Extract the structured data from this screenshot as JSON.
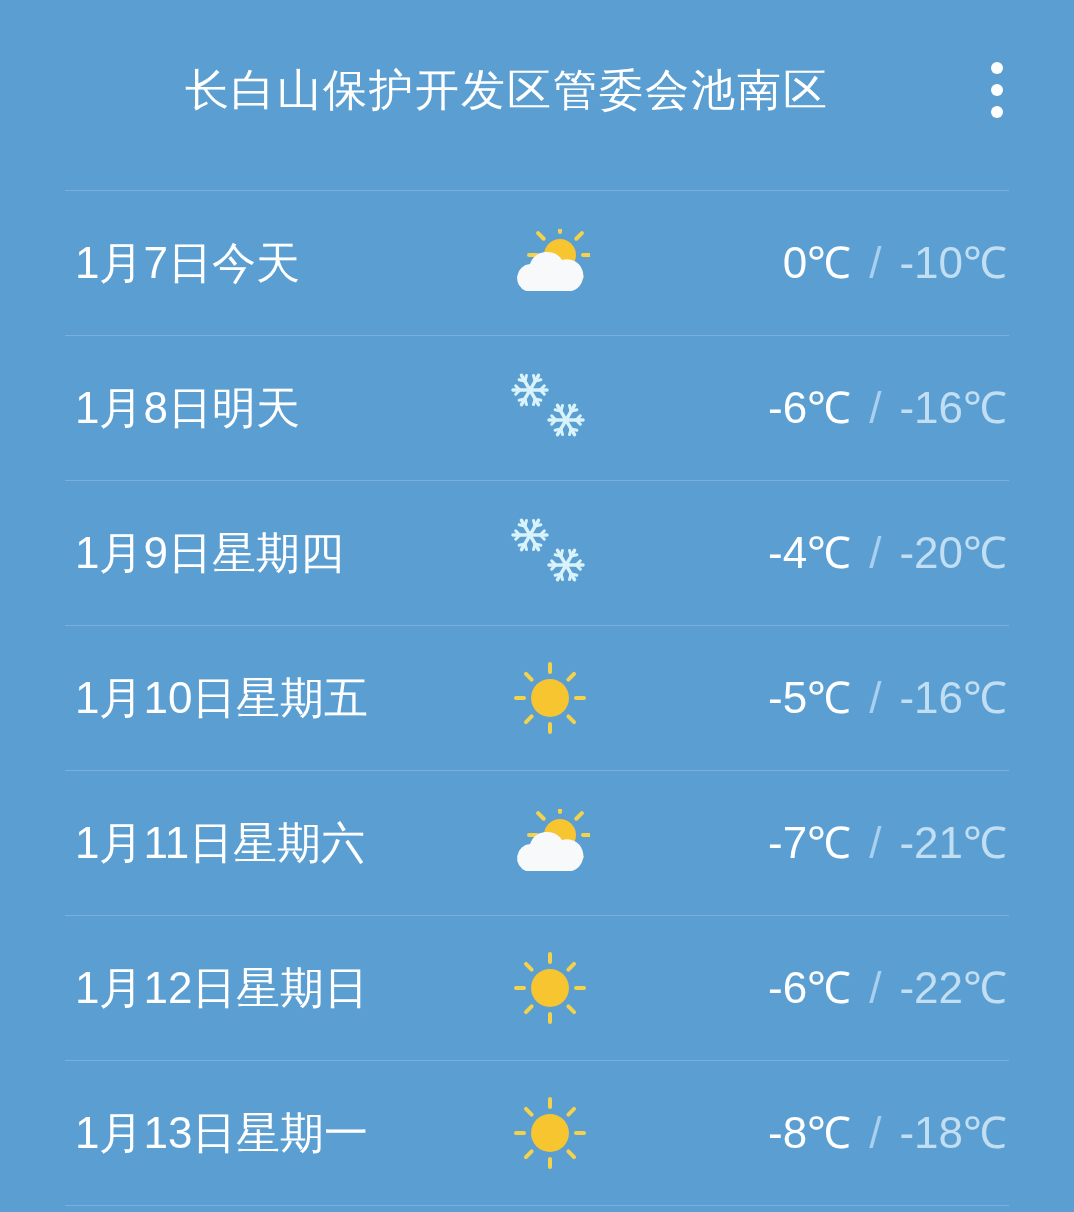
{
  "header": {
    "title": "长白山保护开发区管委会池南区"
  },
  "days": [
    {
      "date": "1月7日今天",
      "kind": "partly_cloudy",
      "high": "0℃",
      "separator": "/",
      "low": "-10℃"
    },
    {
      "date": "1月8日明天",
      "kind": "snow",
      "high": "-6℃",
      "separator": "/",
      "low": "-16℃"
    },
    {
      "date": "1月9日星期四",
      "kind": "snow",
      "high": "-4℃",
      "separator": "/",
      "low": "-20℃"
    },
    {
      "date": "1月10日星期五",
      "kind": "sunny",
      "high": "-5℃",
      "separator": "/",
      "low": "-16℃"
    },
    {
      "date": "1月11日星期六",
      "kind": "partly_cloudy",
      "high": "-7℃",
      "separator": "/",
      "low": "-21℃"
    },
    {
      "date": "1月12日星期日",
      "kind": "sunny",
      "high": "-6℃",
      "separator": "/",
      "low": "-22℃"
    },
    {
      "date": "1月13日星期一",
      "kind": "sunny",
      "high": "-8℃",
      "separator": "/",
      "low": "-18℃"
    }
  ]
}
